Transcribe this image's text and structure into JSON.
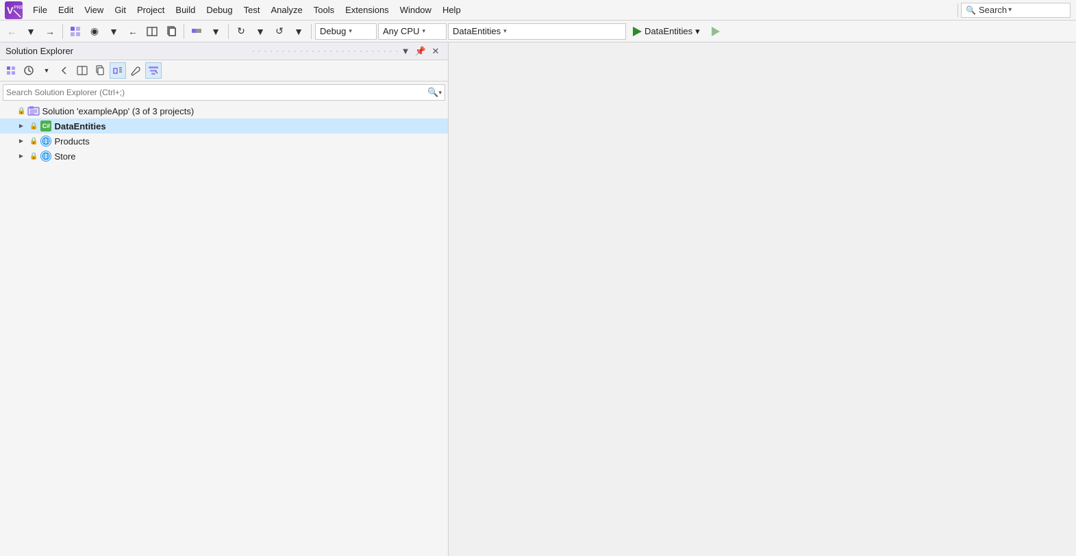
{
  "menubar": {
    "logo_label": "Visual Studio PRE",
    "items": [
      {
        "label": "File"
      },
      {
        "label": "Edit"
      },
      {
        "label": "View"
      },
      {
        "label": "Git"
      },
      {
        "label": "Project"
      },
      {
        "label": "Build"
      },
      {
        "label": "Debug"
      },
      {
        "label": "Test"
      },
      {
        "label": "Analyze"
      },
      {
        "label": "Tools"
      },
      {
        "label": "Extensions"
      },
      {
        "label": "Window"
      },
      {
        "label": "Help"
      }
    ],
    "search_label": "Search",
    "search_dropdown": "▾"
  },
  "toolbar": {
    "config": "Debug",
    "platform": "Any CPU",
    "project": "DataEntities",
    "run_label": "DataEntities",
    "run_dropdown": "▾"
  },
  "solution_explorer": {
    "title": "Solution Explorer",
    "search_placeholder": "Search Solution Explorer (Ctrl+;)",
    "solution_label": "Solution 'exampleApp' (3 of 3 projects)",
    "projects": [
      {
        "name": "DataEntities",
        "type": "csharp",
        "selected": true
      },
      {
        "name": "Products",
        "type": "web",
        "selected": false
      },
      {
        "name": "Store",
        "type": "web",
        "selected": false
      }
    ]
  }
}
